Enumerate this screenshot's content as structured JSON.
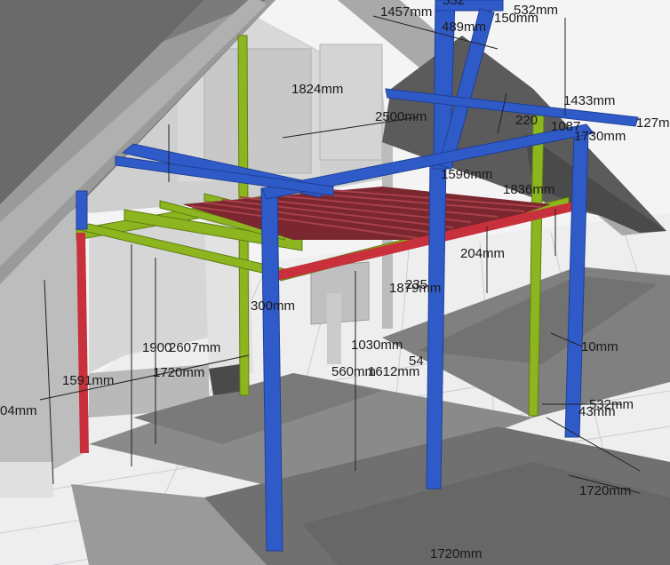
{
  "viewport": {
    "colors": {
      "beam_blue": "#2f5bc9",
      "beam_green": "#8cb51f",
      "beam_red": "#c8313b",
      "joist_dark_red": "#7a2730",
      "roof_gray": "#7b7b7b",
      "wall_gray": "#c9c9c9",
      "floor_gray": "#8a8a8a",
      "grid_line": "#c9ccd6"
    }
  },
  "dimensions": [
    {
      "id": "d-top-1",
      "text": "1457mm"
    },
    {
      "id": "d-top-2",
      "text": "532mm"
    },
    {
      "id": "d-top-3",
      "text": "489mm"
    },
    {
      "id": "d-top-4",
      "text": "150mm"
    },
    {
      "id": "d-top-5",
      "text": "532"
    },
    {
      "id": "d-1824",
      "text": "1824mm"
    },
    {
      "id": "d-2500",
      "text": "2500mm"
    },
    {
      "id": "d-1433",
      "text": "1433mm"
    },
    {
      "id": "d-127",
      "text": "127m"
    },
    {
      "id": "d-220",
      "text": "220"
    },
    {
      "id": "d-1087",
      "text": "1087"
    },
    {
      "id": "d-1730",
      "text": "1730mm"
    },
    {
      "id": "d-1596",
      "text": "1596mm"
    },
    {
      "id": "d-1836",
      "text": "1836mm"
    },
    {
      "id": "d-204",
      "text": "204mm"
    },
    {
      "id": "d-235",
      "text": "235"
    },
    {
      "id": "d-1879",
      "text": "1879mm"
    },
    {
      "id": "d-300",
      "text": "300mm"
    },
    {
      "id": "d-1900",
      "text": "1900"
    },
    {
      "id": "d-2607",
      "text": "2607mm"
    },
    {
      "id": "d-1720a",
      "text": "1720mm"
    },
    {
      "id": "d-1591",
      "text": "1591mm"
    },
    {
      "id": "d-04",
      "text": "04mm"
    },
    {
      "id": "d-1030",
      "text": "1030mm"
    },
    {
      "id": "d-560",
      "text": "560mm"
    },
    {
      "id": "d-1612",
      "text": "1612mm"
    },
    {
      "id": "d-54",
      "text": "54"
    },
    {
      "id": "d-10",
      "text": "10mm"
    },
    {
      "id": "d-532b",
      "text": "532mm"
    },
    {
      "id": "d-43",
      "text": "43mm"
    },
    {
      "id": "d-1720b",
      "text": "1720mm"
    },
    {
      "id": "d-1720c",
      "text": "1720mm"
    }
  ]
}
